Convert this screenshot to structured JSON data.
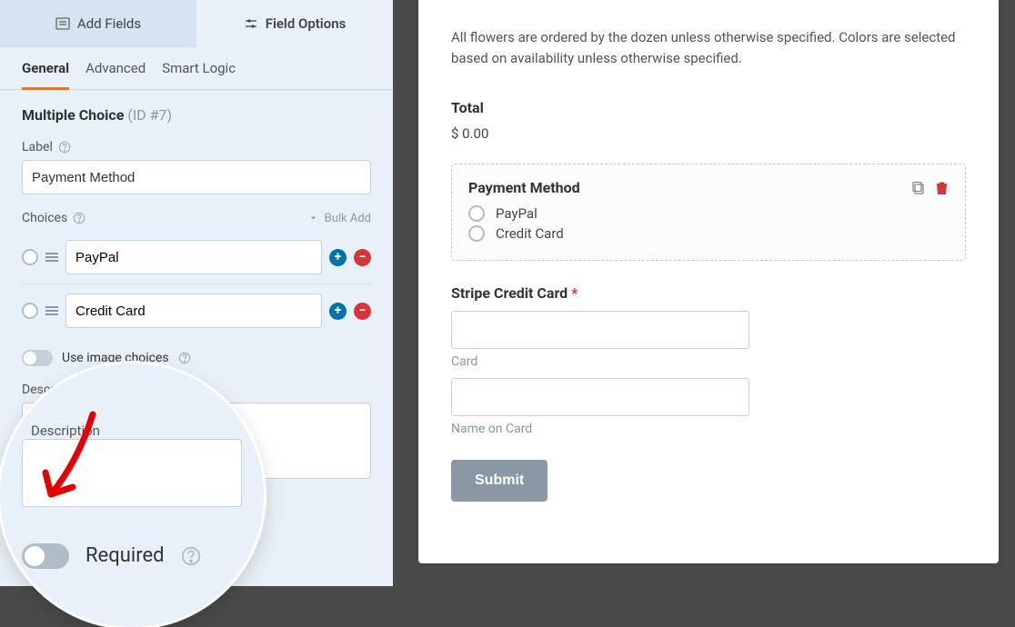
{
  "sidebar": {
    "tab_add_fields": "Add Fields",
    "tab_field_options": "Field Options",
    "subtabs": {
      "general": "General",
      "advanced": "Advanced",
      "smart": "Smart Logic"
    },
    "field_type": "Multiple Choice",
    "field_id": "(ID #7)",
    "label_label": "Label",
    "label_value": "Payment Method",
    "choices_label": "Choices",
    "bulk_add": "Bulk Add",
    "choices": [
      "PayPal",
      "Credit Card"
    ],
    "image_choices_label": "Use image choices",
    "description_label": "Description",
    "required_label": "Required"
  },
  "preview": {
    "notice": "All flowers are ordered by the dozen unless otherwise specified. Colors are selected based on availability unless otherwise specified.",
    "total_label": "Total",
    "total_amount": "$ 0.00",
    "payment_method_label": "Payment Method",
    "payment_options": [
      "PayPal",
      "Credit Card"
    ],
    "stripe_label": "Stripe Credit Card",
    "required_mark": "*",
    "card_sub": "Card",
    "name_sub": "Name on Card",
    "submit": "Submit"
  }
}
